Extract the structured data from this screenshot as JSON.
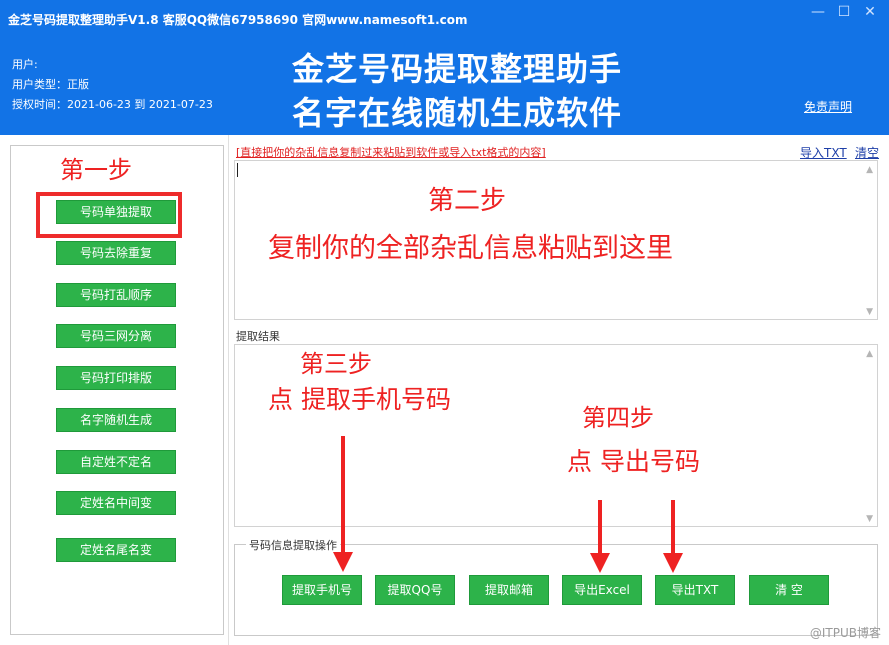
{
  "window": {
    "title": "金芝号码提取整理助手V1.8 客服QQ微信67958690 官网www.namesoft1.com",
    "minimize_glyph": "—",
    "maximize_glyph": "☐",
    "close_glyph": "✕"
  },
  "header": {
    "user_label": "用户:",
    "user_type_label": "用户类型：正版",
    "auth_time_label": "授权时间：2021-06-23 到 2021-07-23",
    "headline_line1": "金芝号码提取整理助手",
    "headline_line2": "名字在线随机生成软件",
    "disclaimer_link": "免责声明"
  },
  "sidebar": {
    "buttons": [
      "号码单独提取",
      "号码去除重复",
      "号码打乱顺序",
      "号码三网分离",
      "号码打印排版",
      "名字随机生成",
      "自定姓不定名",
      "定姓名中间变",
      "定姓名尾名变"
    ]
  },
  "input_area": {
    "instruction": "[直接把你的杂乱信息复制过来粘贴到软件或导入txt格式的内容]",
    "import_txt_link": "导入TXT",
    "clear_link": "清空"
  },
  "results": {
    "label": "提取结果"
  },
  "actions": {
    "group_title": "号码信息提取操作",
    "buttons": [
      "提取手机号",
      "提取QQ号",
      "提取邮箱",
      "导出Excel",
      "导出TXT",
      "清 空"
    ]
  },
  "annotations": {
    "step1": "第一步",
    "step2": "第二步",
    "step2_desc": "复制你的全部杂乱信息粘贴到这里",
    "step3": "第三步",
    "step3_desc": "点 提取手机号码",
    "step4": "第四步",
    "step4_desc": "点 导出号码",
    "accent_color": "#ee2222"
  },
  "watermark": "@ITPUB博客",
  "colors": {
    "titlebar": "#1273e6",
    "button_green": "#2db34a"
  }
}
